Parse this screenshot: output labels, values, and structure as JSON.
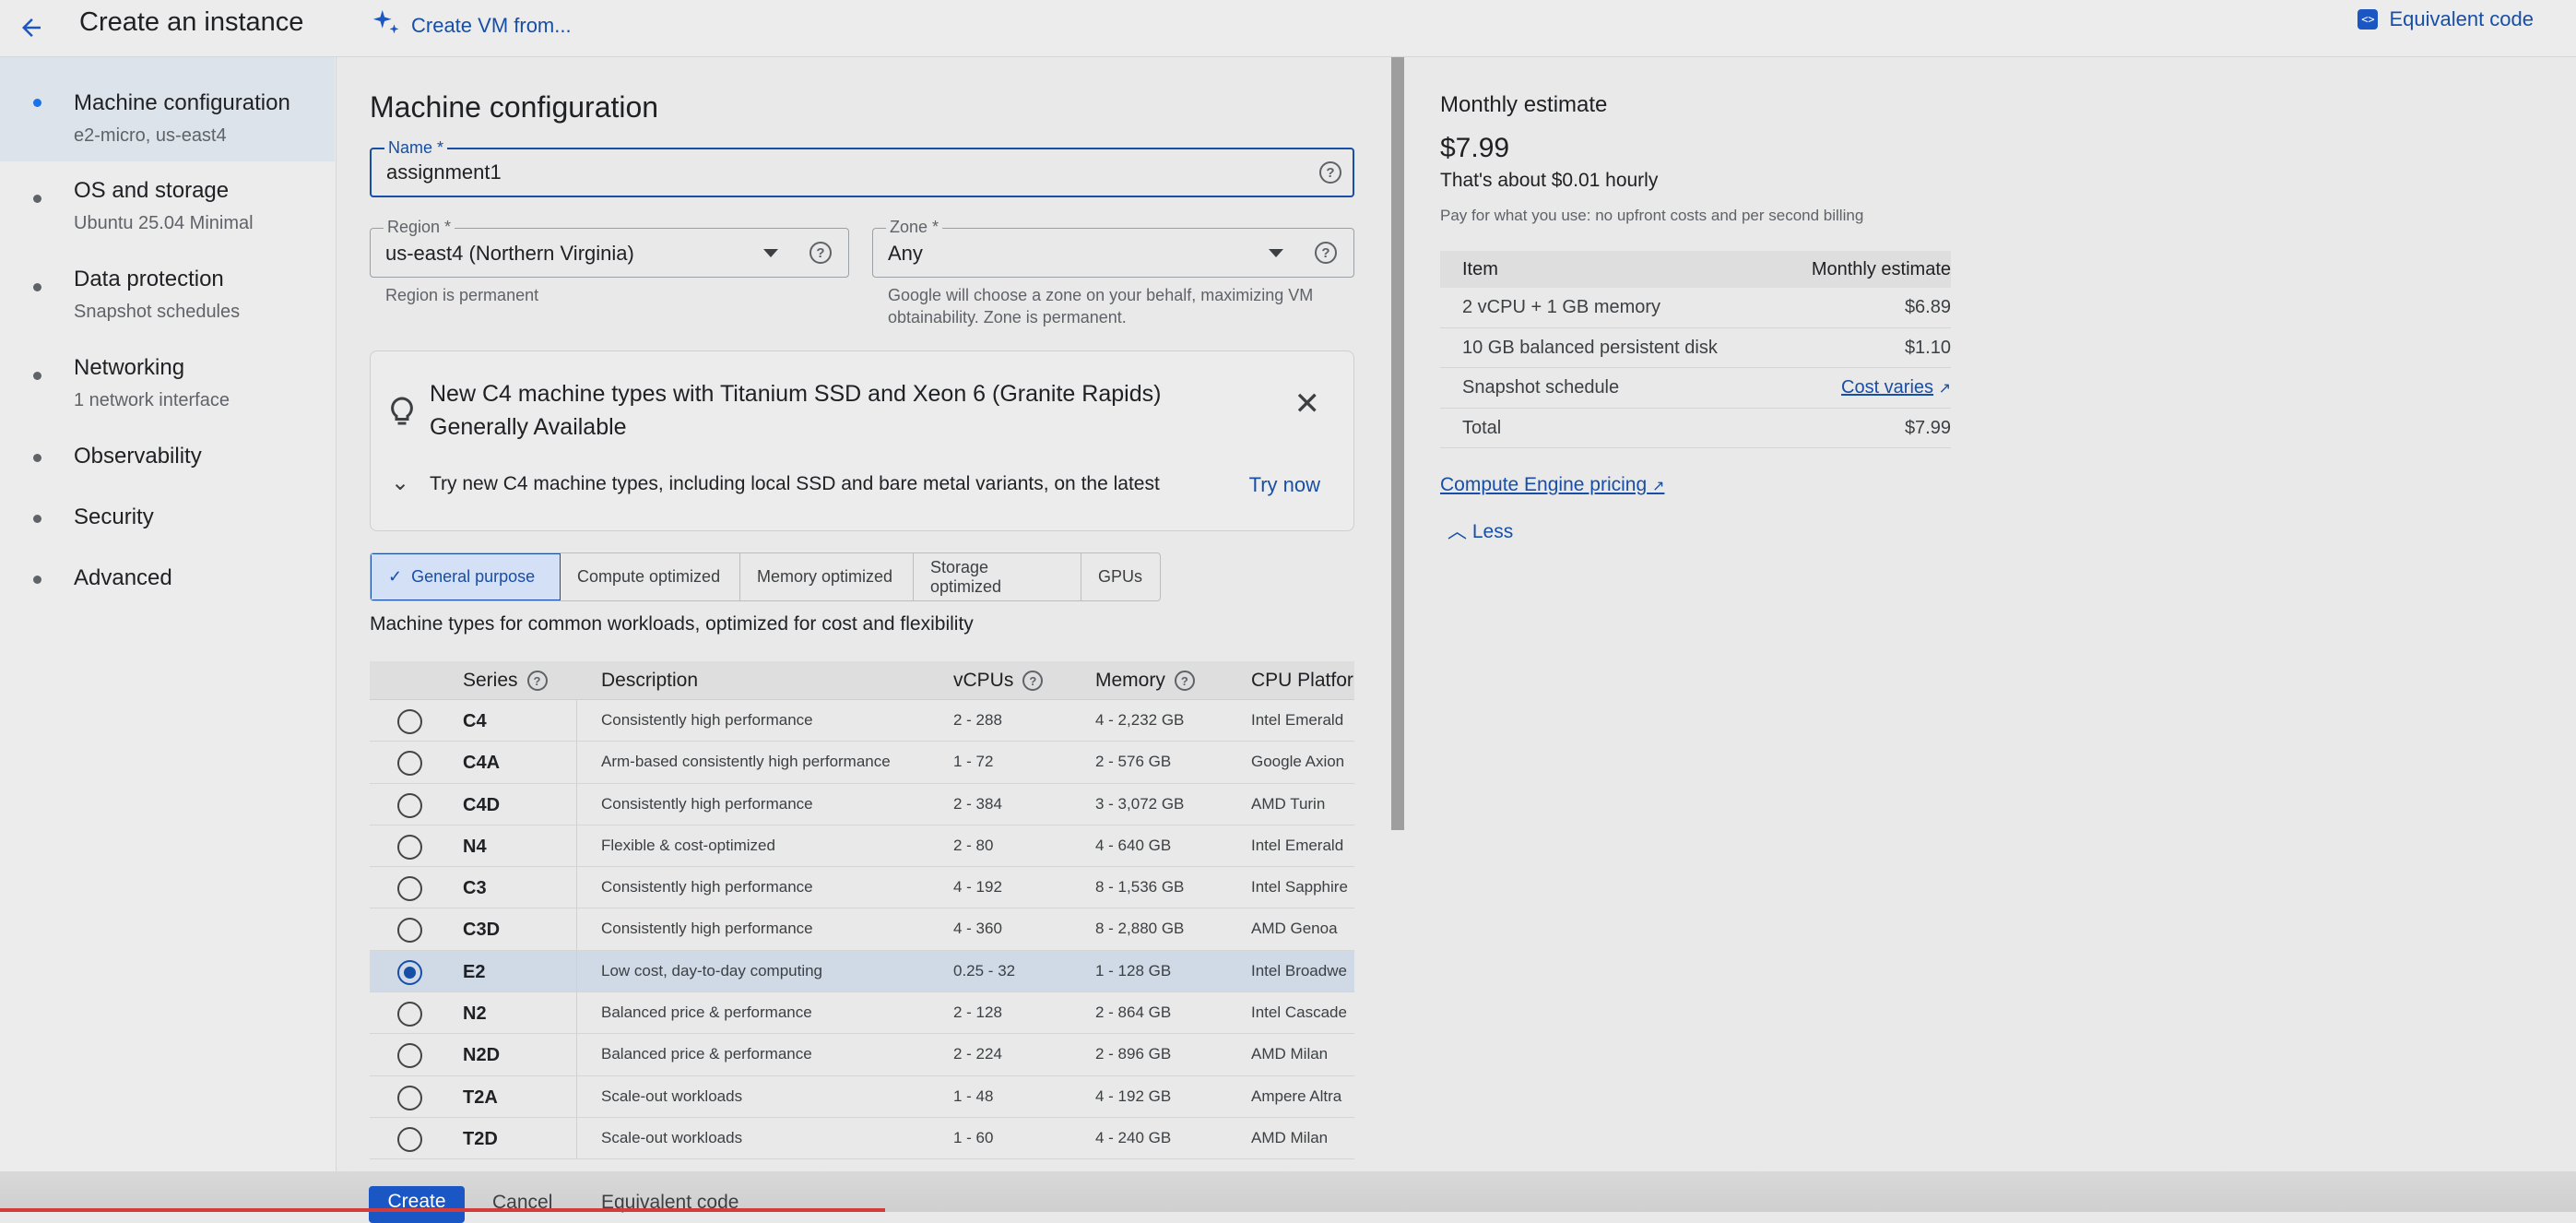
{
  "topbar": {
    "title": "Create an instance",
    "create_from": "Create VM from...",
    "equivalent_code": "Equivalent code"
  },
  "sidebar": {
    "items": [
      {
        "label": "Machine configuration",
        "sub": "e2-micro, us-east4",
        "active": true
      },
      {
        "label": "OS and storage",
        "sub": "Ubuntu 25.04 Minimal"
      },
      {
        "label": "Data protection",
        "sub": "Snapshot schedules"
      },
      {
        "label": "Networking",
        "sub": "1 network interface"
      },
      {
        "label": "Observability",
        "sub": ""
      },
      {
        "label": "Security",
        "sub": ""
      },
      {
        "label": "Advanced",
        "sub": ""
      }
    ]
  },
  "main": {
    "heading": "Machine configuration",
    "name_field": {
      "label": "Name *",
      "value": "assignment1"
    },
    "region_field": {
      "label": "Region *",
      "value": "us-east4 (Northern Virginia)",
      "hint": "Region is permanent"
    },
    "zone_field": {
      "label": "Zone *",
      "value": "Any",
      "hint1": "Google will choose a zone on your behalf, maximizing VM",
      "hint2": "obtainability. Zone is permanent."
    },
    "banner": {
      "title_line1": "New C4 machine types with Titanium SSD and Xeon 6 (Granite Rapids)",
      "title_line2": "Generally Available",
      "text": "Try new C4 machine types, including local SSD and bare metal variants, on the latest",
      "try_now": "Try now"
    },
    "tabs": [
      "General purpose",
      "Compute optimized",
      "Memory optimized",
      "Storage optimized",
      "GPUs"
    ],
    "tabs_description": "Machine types for common workloads, optimized for cost and flexibility",
    "table": {
      "headers": {
        "series": "Series",
        "description": "Description",
        "vcpus": "vCPUs",
        "memory": "Memory",
        "cpu": "CPU Platfor"
      },
      "rows": [
        {
          "series": "C4",
          "desc": "Consistently high performance",
          "vcpus": "2 - 288",
          "memory": "4 - 2,232 GB",
          "cpu": "Intel Emerald"
        },
        {
          "series": "C4A",
          "desc": "Arm-based consistently high performance",
          "vcpus": "1 - 72",
          "memory": "2 - 576 GB",
          "cpu": "Google Axion"
        },
        {
          "series": "C4D",
          "desc": "Consistently high performance",
          "vcpus": "2 - 384",
          "memory": "3 - 3,072 GB",
          "cpu": "AMD Turin"
        },
        {
          "series": "N4",
          "desc": "Flexible & cost-optimized",
          "vcpus": "2 - 80",
          "memory": "4 - 640 GB",
          "cpu": "Intel Emerald"
        },
        {
          "series": "C3",
          "desc": "Consistently high performance",
          "vcpus": "4 - 192",
          "memory": "8 - 1,536 GB",
          "cpu": "Intel Sapphire"
        },
        {
          "series": "C3D",
          "desc": "Consistently high performance",
          "vcpus": "4 - 360",
          "memory": "8 - 2,880 GB",
          "cpu": "AMD Genoa"
        },
        {
          "series": "E2",
          "desc": "Low cost, day-to-day computing",
          "vcpus": "0.25 - 32",
          "memory": "1 - 128 GB",
          "cpu": "Intel Broadwe",
          "selected": true
        },
        {
          "series": "N2",
          "desc": "Balanced price & performance",
          "vcpus": "2 - 128",
          "memory": "2 - 864 GB",
          "cpu": "Intel Cascade"
        },
        {
          "series": "N2D",
          "desc": "Balanced price & performance",
          "vcpus": "2 - 224",
          "memory": "2 - 896 GB",
          "cpu": "AMD Milan"
        },
        {
          "series": "T2A",
          "desc": "Scale-out workloads",
          "vcpus": "1 - 48",
          "memory": "4 - 192 GB",
          "cpu": "Ampere Altra"
        },
        {
          "series": "T2D",
          "desc": "Scale-out workloads",
          "vcpus": "1 - 60",
          "memory": "4 - 240 GB",
          "cpu": "AMD Milan"
        }
      ]
    }
  },
  "estimate": {
    "title": "Monthly estimate",
    "price": "$7.99",
    "hourly": "That's about $0.01 hourly",
    "note": "Pay for what you use: no upfront costs and per second billing",
    "header": {
      "item": "Item",
      "estimate": "Monthly estimate"
    },
    "rows": [
      {
        "item": "2 vCPU + 1 GB memory",
        "value": "$6.89"
      },
      {
        "item": "10 GB balanced persistent disk",
        "value": "$1.10"
      },
      {
        "item": "Snapshot schedule",
        "value": "Cost varies"
      },
      {
        "item": "Total",
        "value": "$7.99"
      }
    ],
    "pricing_link": "Compute Engine pricing",
    "less": "Less"
  },
  "footer": {
    "create": "Create",
    "cancel": "Cancel",
    "equivalent_code": "Equivalent code"
  }
}
